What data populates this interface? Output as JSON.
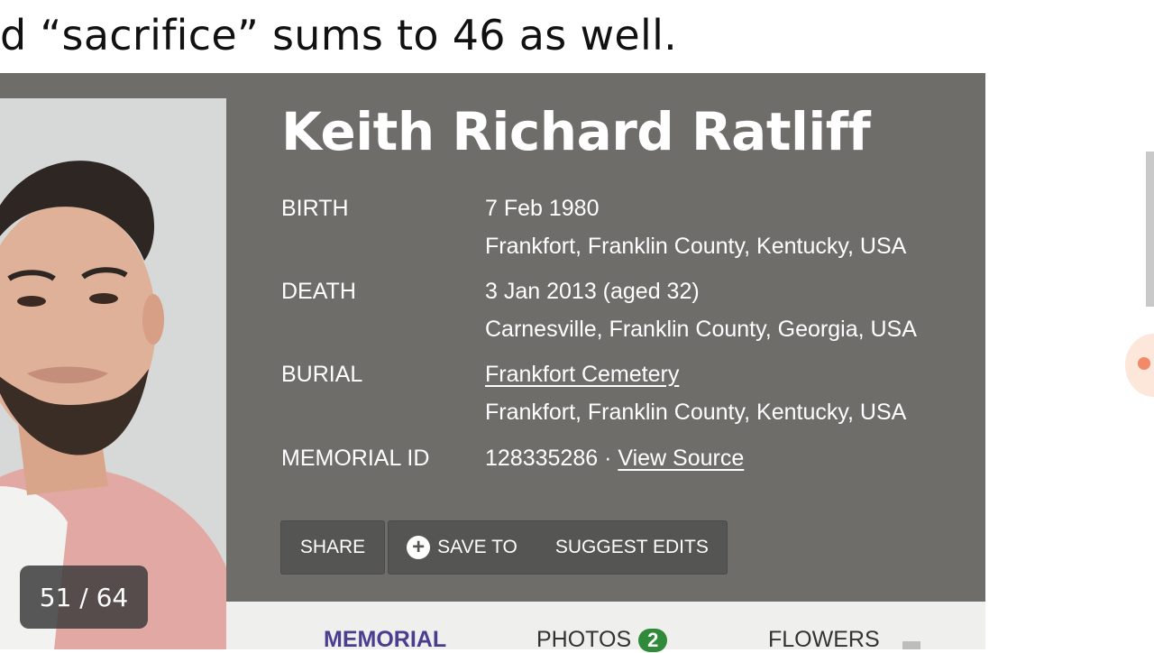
{
  "caption": "d “sacrifice” sums to 46 as well.",
  "memorial": {
    "name": "Keith Richard Ratliff",
    "birth": {
      "label": "BIRTH",
      "date": "7 Feb 1980",
      "place": "Frankfort, Franklin County, Kentucky, USA"
    },
    "death": {
      "label": "DEATH",
      "date": "3 Jan 2013 (aged 32)",
      "place": "Carnesville, Franklin County, Georgia, USA"
    },
    "burial": {
      "label": "BURIAL",
      "cemetery": "Frankfort Cemetery",
      "place": "Frankfort, Franklin County, Kentucky, USA"
    },
    "memorial_id": {
      "label": "MEMORIAL ID",
      "value": "128335286",
      "separator": "·",
      "source_link": "View Source"
    }
  },
  "buttons": {
    "share": "SHARE",
    "save_to": "SAVE TO",
    "suggest_edits": "SUGGEST EDITS",
    "plus_icon": "plus-circle-icon"
  },
  "tabs": {
    "memorial": "MEMORIAL",
    "photos": "PHOTOS",
    "photos_count": "2",
    "flowers": "FLOWERS"
  },
  "slide_counter": "51 / 64",
  "colors": {
    "panel": "#6e6d6a",
    "accent_tab": "#4b3e8f",
    "badge": "#2f8a3a"
  }
}
